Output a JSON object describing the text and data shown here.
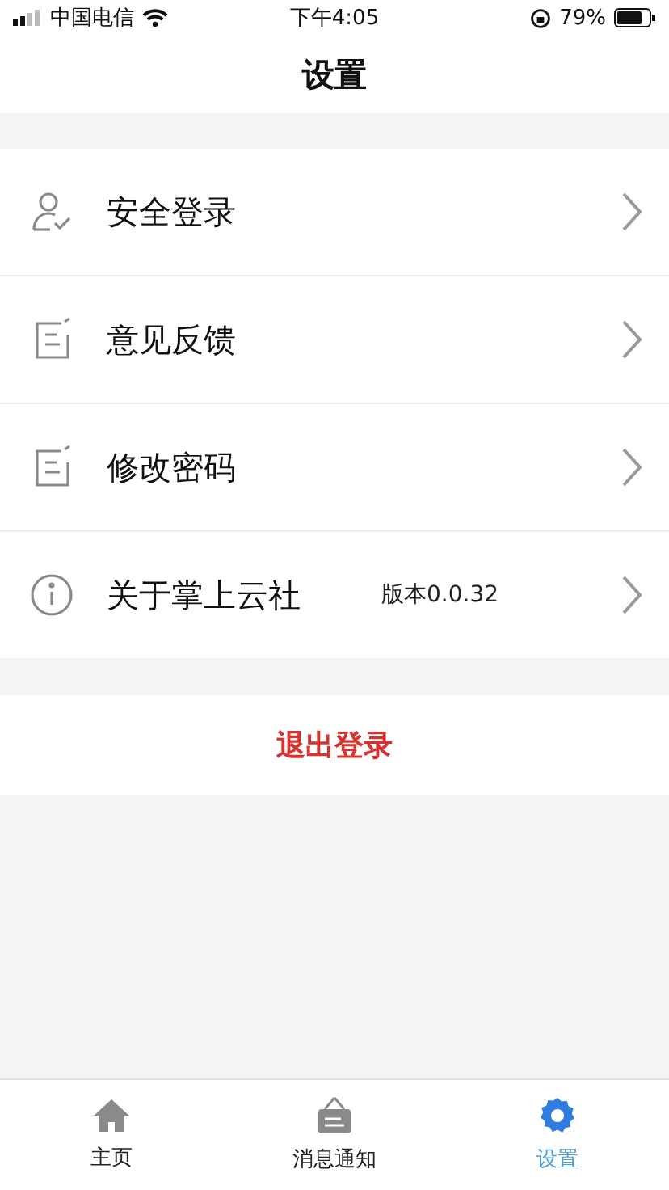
{
  "status_bar": {
    "carrier": "中国电信",
    "time": "下午4:05",
    "battery": "79%"
  },
  "header": {
    "title": "设置"
  },
  "menu": [
    {
      "kind": "user",
      "label": "安全登录"
    },
    {
      "kind": "note",
      "label": "意见反馈"
    },
    {
      "kind": "note",
      "label": "修改密码"
    },
    {
      "kind": "info",
      "label": "关于掌上云社",
      "detail": "版本0.0.32"
    }
  ],
  "logout": {
    "label": "退出登录"
  },
  "tab_bar": [
    {
      "kind": "home",
      "label": "主页",
      "selected": false
    },
    {
      "kind": "board",
      "label": "消息通知",
      "selected": false
    },
    {
      "kind": "gear",
      "label": "设置",
      "selected": true
    }
  ]
}
